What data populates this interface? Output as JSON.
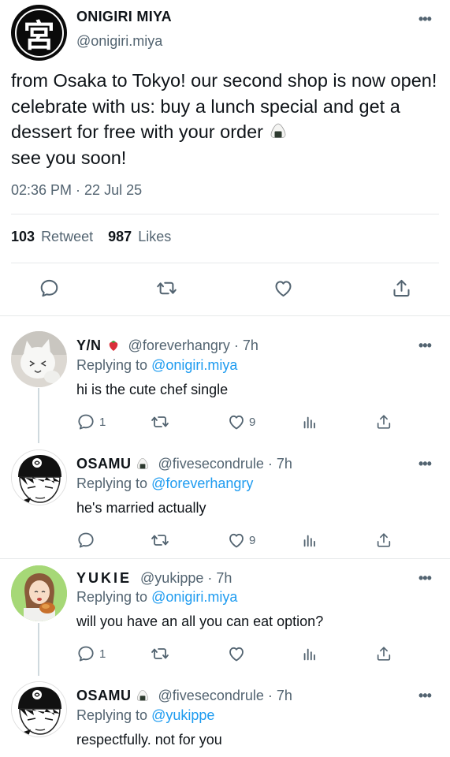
{
  "main_tweet": {
    "display_name": "ONIGIRI MIYA",
    "handle": "@onigiri.miya",
    "avatar_glyph": "宮",
    "text": "from Osaka to Tokyo! our second shop is now open! celebrate with us: buy a lunch special and get a dessert for free with your order",
    "text_end": "see you soon!",
    "timestamp": "02:36 PM · 22 Jul 25",
    "retweets_count": "103",
    "retweets_label": "Retweet",
    "likes_count": "987",
    "likes_label": "Likes"
  },
  "more_glyph": "•••",
  "replies": [
    {
      "display_name": "Y/N",
      "badge_emoji": "strawberry",
      "handle": "@foreverhangry",
      "time": "· 7h",
      "replying_prefix": "Replying to",
      "replying_to": "@onigiri.miya",
      "text": "hi is the cute chef single",
      "reply_count": "1",
      "like_count": "9"
    },
    {
      "display_name": "OSAMU",
      "badge_emoji": "onigiri",
      "handle": "@fivesecondrule",
      "time": "· 7h",
      "replying_prefix": "Replying to",
      "replying_to": "@foreverhangry",
      "text": "he's married actually",
      "reply_count": "",
      "like_count": "9"
    },
    {
      "display_name": "YUKIE",
      "badge_emoji": "",
      "handle": "@yukippe",
      "time": "· 7h",
      "replying_prefix": "Replying to",
      "replying_to": "@onigiri.miya",
      "text": "will you have an all you can eat option?",
      "reply_count": "1",
      "like_count": ""
    },
    {
      "display_name": "OSAMU",
      "badge_emoji": "onigiri",
      "handle": "@fivesecondrule",
      "time": "· 7h",
      "replying_prefix": "Replying to",
      "replying_to": "@yukippe",
      "text": "respectfully. not for you",
      "reply_count": "",
      "like_count": ""
    }
  ],
  "icons": {
    "reply": "speech-bubble-icon",
    "retweet": "retweet-arrows-icon",
    "like": "heart-icon",
    "share": "share-upload-icon",
    "analytics": "bar-chart-icon"
  },
  "colors": {
    "text": "#0f1419",
    "secondary": "#536471",
    "link": "#1d9bf0",
    "divider": "#e6e9ea"
  }
}
